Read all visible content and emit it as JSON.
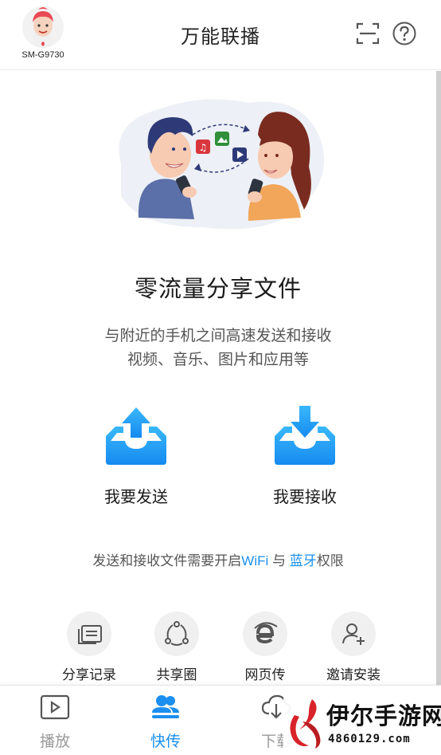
{
  "header": {
    "device_name": "SM-G9730",
    "title": "万能联播",
    "scan_icon": "scan-icon",
    "help_icon": "help-icon"
  },
  "main": {
    "headline": "零流量分享文件",
    "desc_line1": "与附近的手机之间高速发送和接收",
    "desc_line2": "视频、音乐、图片和应用等",
    "send_label": "我要发送",
    "receive_label": "我要接收",
    "permission": {
      "prefix": "发送和接收文件需要开启",
      "wifi": "WiFi",
      "mid": " 与 ",
      "bluetooth": "蓝牙",
      "suffix": "权限"
    },
    "tools": [
      {
        "label": "分享记录",
        "icon": "share-history-icon"
      },
      {
        "label": "共享圈",
        "icon": "share-circle-icon"
      },
      {
        "label": "网页传",
        "icon": "web-transfer-icon"
      },
      {
        "label": "邀请安装",
        "icon": "invite-install-icon"
      }
    ]
  },
  "bottom_nav": {
    "items": [
      {
        "label": "播放",
        "icon": "play-icon",
        "active": false
      },
      {
        "label": "快传",
        "icon": "quick-transfer-icon",
        "active": true
      },
      {
        "label": "下载",
        "icon": "download-icon",
        "active": false
      }
    ]
  },
  "watermark": {
    "title": "伊尔手游网",
    "url": "4860129.com"
  },
  "colors": {
    "accent": "#1a8ff0",
    "icon_blue": "#1e9bf0",
    "inactive": "#9a9a9a"
  }
}
